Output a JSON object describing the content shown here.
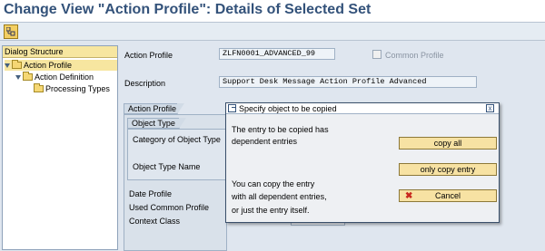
{
  "header": {
    "title": "Change View \"Action Profile\": Details of Selected Set"
  },
  "toolbar": {
    "buttons": [
      {
        "icon": "structure-toggle-icon"
      }
    ]
  },
  "sidebar": {
    "heading": "Dialog Structure",
    "items": [
      {
        "label": "Action Profile"
      },
      {
        "label": "Action Definition"
      },
      {
        "label": "Processing Types"
      }
    ]
  },
  "form": {
    "action_profile_label": "Action Profile",
    "action_profile_value": "ZLFN0001_ADVANCED_99",
    "common_profile_label": "Common Profile",
    "description_label": "Description",
    "description_value": "Support Desk Message Action Profile Advanced",
    "group_tab": "Action Profile",
    "object_type_tab": "Object Type",
    "category_label": "Category of Object Type",
    "object_type_name_label": "Object Type Name",
    "date_profile_label": "Date Profile",
    "used_common_profile_label": "Used Common Profile",
    "context_class_label": "Context Class"
  },
  "dialog": {
    "title": "Specify object to be copied",
    "close_glyph": "x",
    "text1_line1": "The entry to be copied has",
    "text1_line2": "dependent entries",
    "text2_line1": "You can copy the entry",
    "text2_line2": "with all dependent entries,",
    "text2_line3": "or just the entry itself.",
    "copy_all": "copy all",
    "only_copy_entry": "only copy entry",
    "cancel": "Cancel",
    "cancel_glyph": "✖"
  },
  "colors": {
    "title": "#33527a",
    "button": "#f7e2a3",
    "selection": "#f7e6a0",
    "cancel_icon": "#c8281e"
  }
}
